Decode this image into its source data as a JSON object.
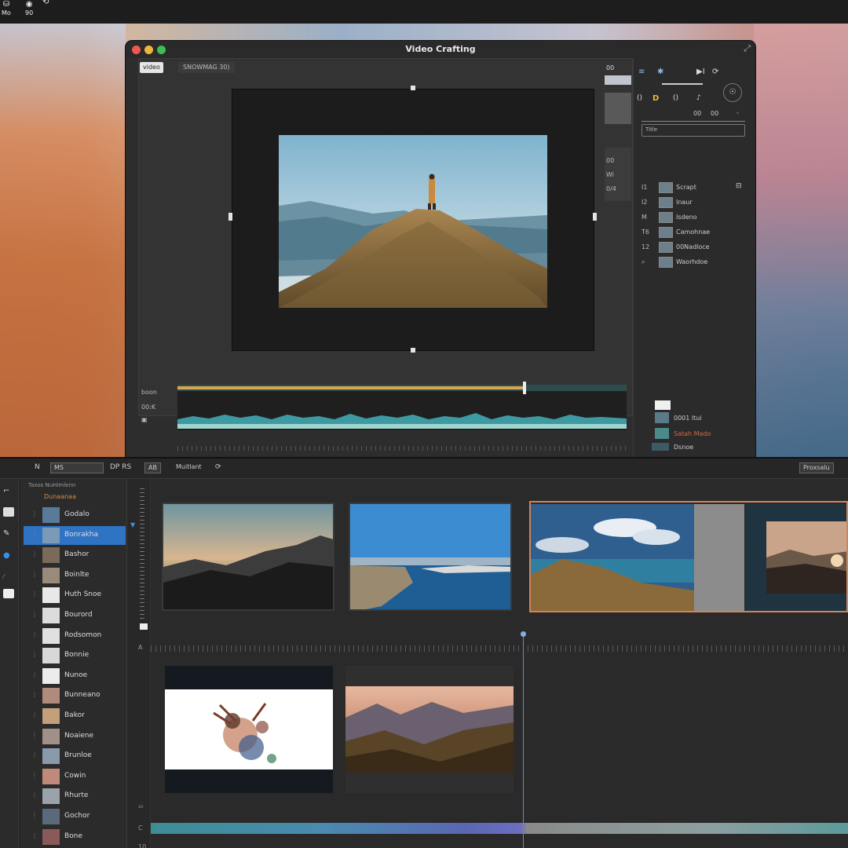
{
  "menubar": {
    "items": [
      {
        "icon": "folder-icon",
        "label": "Mo"
      },
      {
        "icon": "eye-icon",
        "label": "90"
      },
      {
        "icon": "loop-icon",
        "label": ""
      }
    ]
  },
  "window": {
    "title": "Video Crafting",
    "viewer_tag": "video",
    "viewer_name": "SNOWMAG 30)",
    "side_labels": [
      "00",
      "Wi",
      "0/4"
    ],
    "header_count": "00"
  },
  "inspector": {
    "top_icons": [
      "≡",
      "✱",
      "▶I",
      "⟳",
      "☉"
    ],
    "row_icons": [
      "()",
      "D",
      "()",
      "♪"
    ],
    "meta": [
      "00",
      "00",
      "◦"
    ],
    "search_label": "Title",
    "items": [
      {
        "num": "I1",
        "label": "Scrapt"
      },
      {
        "num": "I2",
        "label": "Inaur"
      },
      {
        "num": "M",
        "label": "Isdeno"
      },
      {
        "num": "T6",
        "label": "Camohnae"
      },
      {
        "num": "12",
        "label": "00Nadloce"
      },
      {
        "num": "⌕",
        "label": "Waorhdoe"
      }
    ]
  },
  "audio": {
    "labels": [
      "boon",
      "00:K",
      "▣"
    ]
  },
  "assets": [
    {
      "label": "0001 ltui",
      "color": "#cccccc"
    },
    {
      "label": "Satah Mado",
      "color": "#d26a4a"
    },
    {
      "label": "Dsnoe",
      "color": "#cccccc"
    }
  ],
  "toolbar": {
    "items": [
      "N",
      "MS",
      "DP RS",
      "AB",
      "Muitlant",
      "⟳"
    ],
    "right_label": "Proxsalu"
  },
  "browser": {
    "header": "Taxos  NuHimlenn",
    "title": "Dunaanaa",
    "items": [
      {
        "label": "Godalo",
        "selected": false
      },
      {
        "label": "Bonrakha",
        "selected": true
      },
      {
        "label": "Bashor",
        "selected": false
      },
      {
        "label": "Boinlte",
        "selected": false
      },
      {
        "label": "Huth Snoe",
        "selected": false
      },
      {
        "label": "Bourord",
        "selected": false
      },
      {
        "label": "Rodsomon",
        "selected": false
      },
      {
        "label": "Bonnie",
        "selected": false
      },
      {
        "label": "Nunoe",
        "selected": false
      },
      {
        "label": "Bunneano",
        "selected": false
      },
      {
        "label": "Bakor",
        "selected": false
      },
      {
        "label": "Noaiene",
        "selected": false
      },
      {
        "label": "Brunloe",
        "selected": false
      },
      {
        "label": "Cowin",
        "selected": false
      },
      {
        "label": "Rhurte",
        "selected": false
      },
      {
        "label": "Gochor",
        "selected": false
      },
      {
        "label": "Bone",
        "selected": false
      }
    ]
  },
  "timeline": {
    "markers": [
      "A",
      "₂₀",
      "C",
      "10"
    ]
  },
  "colors": {
    "accent": "#2f73c5",
    "clip_highlight": "#d0845a",
    "waveform": "#3d9aa3"
  }
}
